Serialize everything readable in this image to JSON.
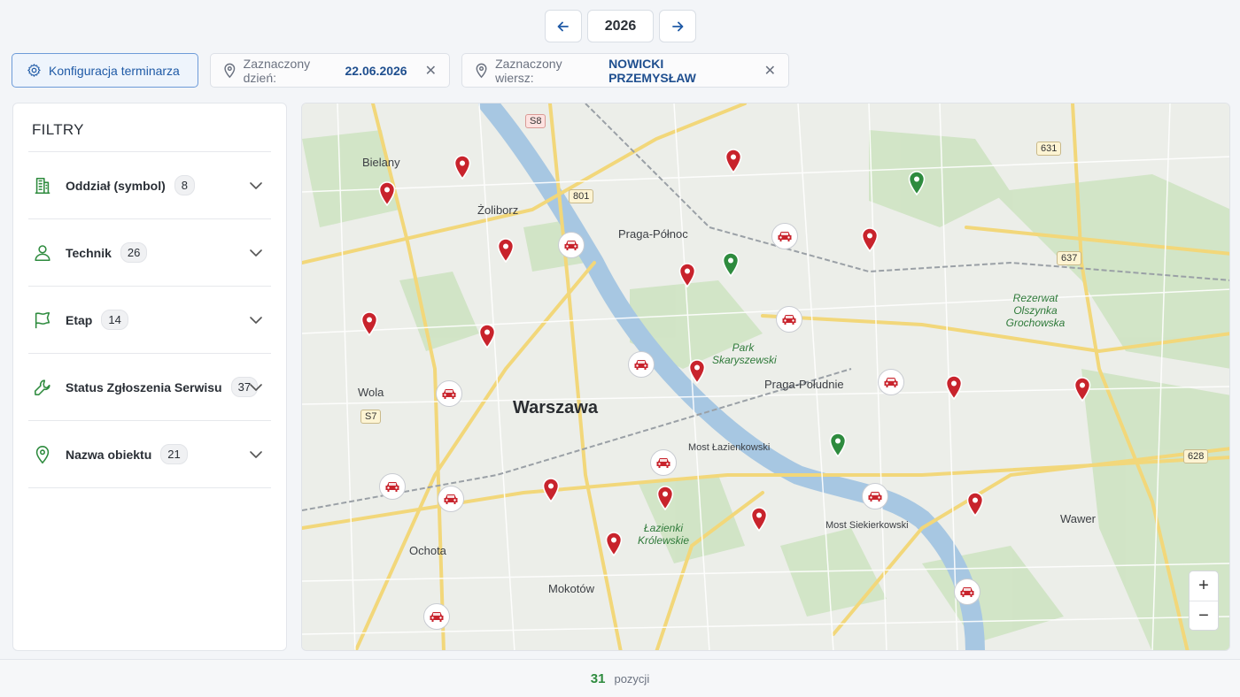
{
  "year_nav": {
    "year": "2026",
    "prev_icon": "arrow-left-icon",
    "next_icon": "arrow-right-icon"
  },
  "toolbar": {
    "config_label": "Konfiguracja terminarza",
    "day_label": "Zaznaczony dzień:",
    "day_value": "22.06.2026",
    "row_label": "Zaznaczony wiersz:",
    "row_value": "NOWICKI PRZEMYSŁAW"
  },
  "sidebar": {
    "title": "FILTRY",
    "filters": [
      {
        "label": "Oddział (symbol)",
        "count": "8",
        "icon": "building-icon"
      },
      {
        "label": "Technik",
        "count": "26",
        "icon": "user-icon"
      },
      {
        "label": "Etap",
        "count": "14",
        "icon": "flag-icon"
      },
      {
        "label": "Status Zgłoszenia Serwisu",
        "count": "37",
        "icon": "wrench-icon"
      },
      {
        "label": "Nazwa obiektu",
        "count": "21",
        "icon": "location-pin-icon"
      }
    ]
  },
  "map": {
    "labels": {
      "bielany": "Bielany",
      "zoliborz": "Żoliborz",
      "praga_polnoc": "Praga-Północ",
      "wola": "Wola",
      "warszawa": "Warszawa",
      "praga_poludnie": "Praga-Południe",
      "most_lazienkowski": "Most Łazienkowski",
      "ochota": "Ochota",
      "mokotow": "Mokotów",
      "most_siekierkowski": "Most Siekierkowski",
      "wawer": "Wawer",
      "park_skaryszewski": "Park Skaryszewski",
      "lazienki": "Łazienki Królewskie",
      "rezerwat": "Rezerwat Olszynka Grochowska"
    },
    "road_signs": {
      "s8": "S8",
      "r801": "801",
      "r631": "631",
      "r637": "637",
      "s7": "S7",
      "r628": "628"
    },
    "zoom_in": "+",
    "zoom_out": "−",
    "marker_colors": {
      "red": "#c8232c",
      "green": "#2e8b3e"
    },
    "markers": [
      {
        "type": "pin",
        "color": "red"
      },
      {
        "type": "pin",
        "color": "red"
      },
      {
        "type": "pin",
        "color": "red"
      },
      {
        "type": "pin",
        "color": "red"
      },
      {
        "type": "pin",
        "color": "green"
      },
      {
        "type": "pin",
        "color": "red"
      },
      {
        "type": "pin",
        "color": "green"
      },
      {
        "type": "pin",
        "color": "red"
      },
      {
        "type": "pin",
        "color": "red"
      },
      {
        "type": "pin",
        "color": "red"
      },
      {
        "type": "pin",
        "color": "red"
      },
      {
        "type": "pin",
        "color": "red"
      },
      {
        "type": "pin",
        "color": "red"
      },
      {
        "type": "pin",
        "color": "green"
      },
      {
        "type": "pin",
        "color": "red"
      },
      {
        "type": "pin",
        "color": "red"
      },
      {
        "type": "pin",
        "color": "red"
      },
      {
        "type": "pin",
        "color": "red"
      },
      {
        "type": "pin",
        "color": "red"
      },
      {
        "type": "car"
      },
      {
        "type": "car"
      },
      {
        "type": "car"
      },
      {
        "type": "car"
      },
      {
        "type": "car"
      },
      {
        "type": "car"
      },
      {
        "type": "car"
      },
      {
        "type": "car"
      },
      {
        "type": "car"
      },
      {
        "type": "car"
      },
      {
        "type": "car"
      },
      {
        "type": "car"
      }
    ]
  },
  "footer": {
    "count": "31",
    "unit": "pozycji"
  }
}
